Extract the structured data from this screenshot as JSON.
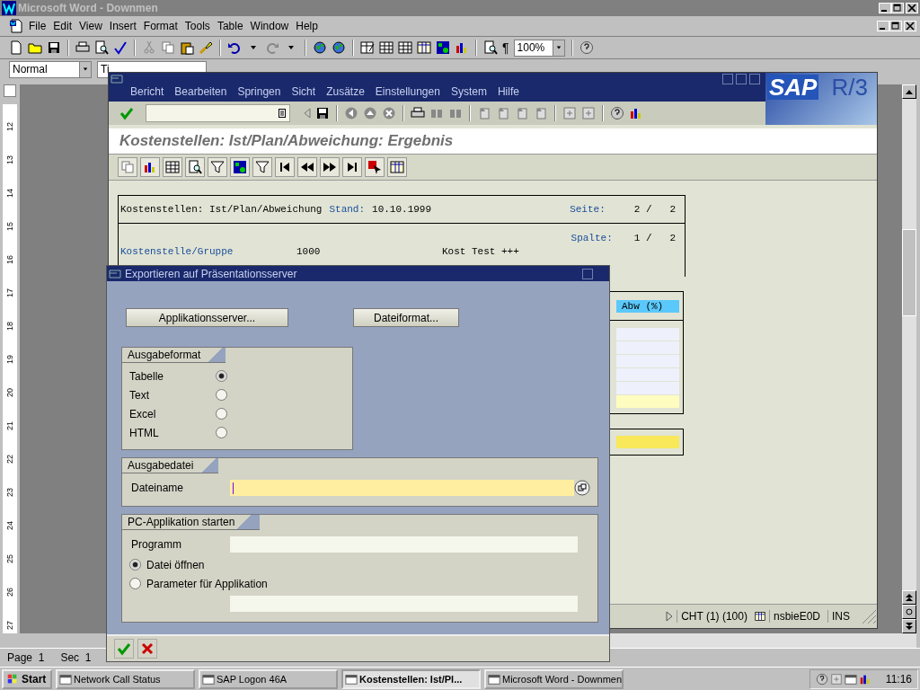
{
  "word": {
    "title": "Microsoft Word - Downmen",
    "menu": [
      "File",
      "Edit",
      "View",
      "Insert",
      "Format",
      "Tools",
      "Table",
      "Window",
      "Help"
    ],
    "pilcrow": "¶",
    "zoom": "100%",
    "style": "Normal",
    "font": "Ti",
    "ruler": [
      "12",
      "13",
      "14",
      "15",
      "16",
      "17",
      "18",
      "19",
      "20",
      "21",
      "22",
      "23",
      "24",
      "25",
      "26",
      "27"
    ],
    "status": [
      "Page  1",
      "Sec  1"
    ]
  },
  "sap": {
    "menu": [
      "Bericht",
      "Bearbeiten",
      "Springen",
      "Sicht",
      "Zusätze",
      "Einstellungen",
      "System",
      "Hilfe"
    ],
    "logo": {
      "brand": "SAP",
      "product": "R/3"
    },
    "title": "Kostenstellen: Ist/Plan/Abweichung: Ergebnis",
    "report": {
      "heading": "Kostenstellen: Ist/Plan/Abweichung",
      "stand_label": "Stand:",
      "stand": "10.10.1999",
      "seite_label": "Seite:",
      "seite": "2 /   2",
      "spalte_label": "Spalte:",
      "spalte": "1 /   2",
      "row_label": "Kostenstelle/Gruppe",
      "row_value": "1000",
      "row_text": "Kost Test +++",
      "column_header": "Abw (%)"
    },
    "status": [
      "CHT (1) (100)",
      "nsbieE0D",
      "INS"
    ]
  },
  "dialog": {
    "title": "Exportieren auf Präsentationsserver",
    "buttons": [
      "Applikationsserver...",
      "Dateiformat..."
    ],
    "format": {
      "title": "Ausgabeformat",
      "options": [
        {
          "label": "Tabelle",
          "selected": true
        },
        {
          "label": "Text",
          "selected": false
        },
        {
          "label": "Excel",
          "selected": false
        },
        {
          "label": "HTML",
          "selected": false
        }
      ]
    },
    "file": {
      "title": "Ausgabedatei",
      "label": "Dateiname"
    },
    "pc": {
      "title": "PC-Applikation starten",
      "label": "Programm",
      "options": [
        {
          "label": "Datei öffnen",
          "selected": true
        },
        {
          "label": "Parameter für Applikation",
          "selected": false
        }
      ]
    }
  },
  "taskbar": {
    "start": "Start",
    "tasks": [
      {
        "label": "Network Call Status",
        "selected": false
      },
      {
        "label": "SAP Logon 46A",
        "selected": false
      },
      {
        "label": "Kostenstellen: Ist/Pl...",
        "selected": true
      },
      {
        "label": "Microsoft Word - Downmen",
        "selected": false
      }
    ],
    "clock": "11:16"
  }
}
